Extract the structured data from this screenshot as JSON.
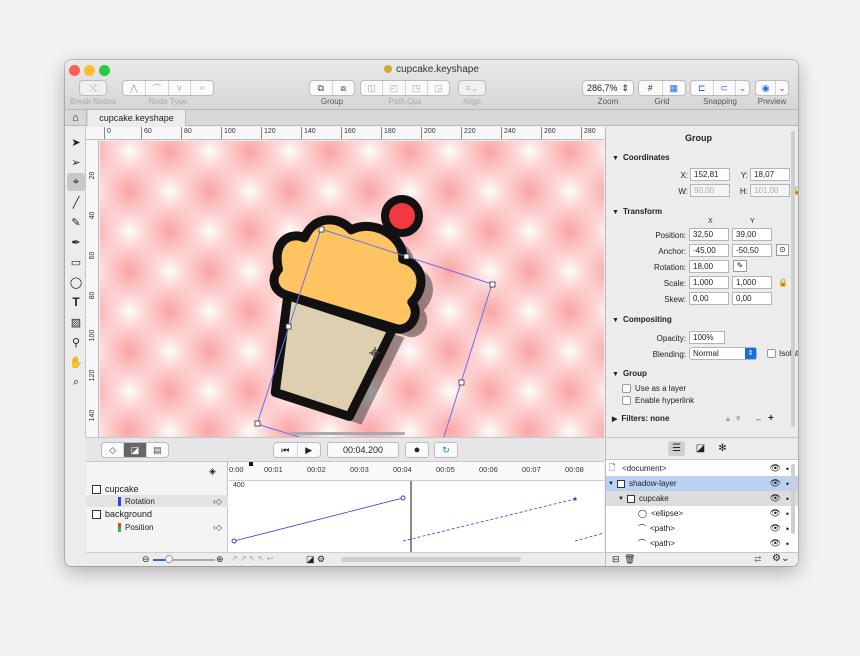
{
  "window": {
    "title": "cupcake.keyshape",
    "traffic_colors": {
      "close": "#fe5f57",
      "minimize": "#febc2e",
      "zoom": "#28c840"
    }
  },
  "toolbar": {
    "break_nodes": {
      "icon": "scissors-node-icon",
      "label": "Break Nodes"
    },
    "node_type": {
      "icons": [
        "corner-node-icon",
        "smooth-node-icon",
        "symmetric-node-icon",
        "auto-node-icon"
      ],
      "label": "Node Type"
    },
    "group": {
      "icons": [
        "group-icon",
        "ungroup-icon"
      ],
      "label": "Group"
    },
    "path_ops": {
      "icons": [
        "union-icon",
        "subtract-icon",
        "intersect-icon",
        "exclude-icon"
      ],
      "label": "Path Ops"
    },
    "align": {
      "icon": "align-icon",
      "label": "Align"
    },
    "zoom": {
      "value": "286,7%",
      "label": "Zoom"
    },
    "grid": {
      "icons": [
        "grid-icon",
        "pixel-grid-icon"
      ],
      "label": "Grid"
    },
    "snapping": {
      "icons": [
        "snap-objects-icon",
        "snap-magnet-icon"
      ],
      "label": "Snapping"
    },
    "preview": {
      "icon": "preview-globe-icon",
      "label": "Preview"
    }
  },
  "tabs": {
    "home_icon": "home-icon",
    "document": "cupcake.keyshape"
  },
  "tools": [
    "select-arrow-icon",
    "direct-select-arrow-icon",
    "node-tool-icon",
    "line-tool-icon",
    "pencil-tool-icon",
    "pen-tool-icon",
    "rectangle-tool-icon",
    "ellipse-tool-icon",
    "text-tool-icon",
    "image-tool-icon",
    "eyedropper-tool-icon",
    "hand-tool-icon",
    "zoom-tool-icon"
  ],
  "ruler": {
    "h": [
      "0",
      "60",
      "80",
      "100",
      "120",
      "140",
      "160",
      "180",
      "200",
      "220",
      "240",
      "260",
      "280"
    ],
    "v": [
      "20",
      "40",
      "60",
      "80",
      "100",
      "120",
      "140"
    ]
  },
  "playback": {
    "time": "00:04.200",
    "icons": [
      "keyframe-mode-icon",
      "graph-mode-icon",
      "list-mode-icon",
      "skip-start-icon",
      "play-icon",
      "record-icon",
      "loop-icon"
    ]
  },
  "timeline": {
    "ticks": [
      "0:00",
      "00:01",
      "00:02",
      "00:03",
      "00:04",
      "00:05",
      "00:06",
      "00:07",
      "00:08"
    ],
    "value_marker": "400",
    "tracks": [
      {
        "name": "cupcake",
        "property": "Rotation",
        "color": "#2f44e0"
      },
      {
        "name": "background",
        "property": "Position",
        "color_top": "#e83b3b",
        "color_bottom": "#3bb54a"
      }
    ]
  },
  "inspector": {
    "title": "Group",
    "coordinates": {
      "header": "Coordinates",
      "x_label": "X:",
      "x": "152,81",
      "y_label": "Y:",
      "y": "18,07",
      "w_label": "W:",
      "w": "90,00",
      "h_label": "H:",
      "h": "101,00"
    },
    "transform": {
      "header": "Transform",
      "col_x": "X",
      "col_y": "Y",
      "position_label": "Position:",
      "position_x": "32,50",
      "position_y": "39,00",
      "anchor_label": "Anchor:",
      "anchor_x": "-45,00",
      "anchor_y": "-50,50",
      "rotation_label": "Rotation:",
      "rotation": "18,00",
      "scale_label": "Scale:",
      "scale_x": "1,000",
      "scale_y": "1,000",
      "skew_label": "Skew:",
      "skew_x": "0,00",
      "skew_y": "0,00"
    },
    "compositing": {
      "header": "Compositing",
      "opacity_label": "Opacity:",
      "opacity": "100%",
      "blending_label": "Blending:",
      "blending": "Normal",
      "isolate_label": "Isolate"
    },
    "group": {
      "header": "Group",
      "use_as_layer": "Use as a layer",
      "enable_hyperlink": "Enable hyperlink"
    },
    "filters": {
      "header": "Filters: none"
    }
  },
  "layers": [
    {
      "name": "<document>",
      "icon": "document-icon",
      "indent": 0
    },
    {
      "name": "shadow-layer",
      "icon": "layer-icon",
      "indent": 0
    },
    {
      "name": "cupcake",
      "icon": "group-layer-icon",
      "indent": 1
    },
    {
      "name": "<ellipse>",
      "icon": "ellipse-layer-icon",
      "indent": 2
    },
    {
      "name": "<path>",
      "icon": "path-layer-icon",
      "indent": 2
    },
    {
      "name": "<path>",
      "icon": "path-layer-icon",
      "indent": 2
    }
  ],
  "colors": {
    "frosting": "#fdc461",
    "cherry": "#f2393f",
    "wrapper": "#ddcfaf",
    "outline": "#111111",
    "bbox": "#6b6ef0",
    "selection": "#b9d2f3"
  }
}
